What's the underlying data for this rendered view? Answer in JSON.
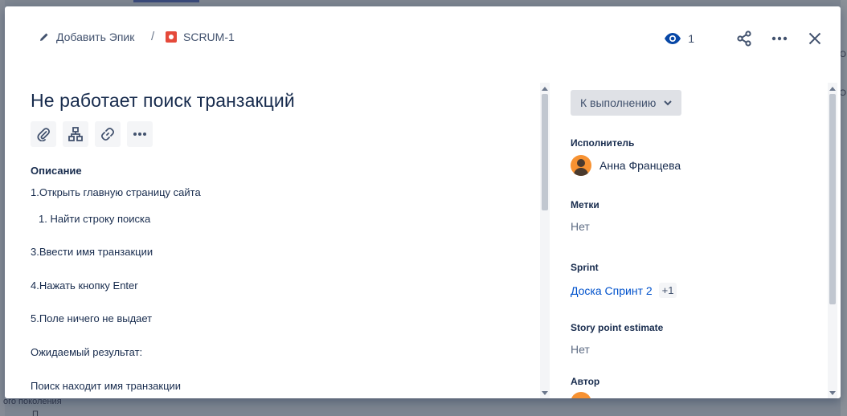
{
  "background": {
    "text_top_right": "Ю",
    "text_mid_right": "О",
    "text_bottom_left": "ого поколения",
    "text_bottom_left2": "П"
  },
  "breadcrumb": {
    "epic_label": "Добавить Эпик",
    "separator": "/",
    "issue_key": "SCRUM-1"
  },
  "header": {
    "watch_count": "1",
    "icons": [
      "eye-icon",
      "share-icon",
      "more-icon",
      "close-icon"
    ]
  },
  "issue": {
    "title": "Не работает поиск транзакций",
    "toolbar_icons": [
      "attachment-icon",
      "child-issue-icon",
      "link-icon",
      "more-icon"
    ],
    "description_label": "Описание",
    "description": [
      "1.Открыть главную страницу сайта",
      "1. Найти строку поиска",
      "3.Ввести имя транзакции",
      "4.Нажать кнопку Enter",
      "5.Поле ничего не выдает",
      "Ожидаемый результат:",
      "Поиск находит имя транзакции"
    ]
  },
  "sidebar": {
    "status": "К выполнению",
    "assignee_label": "Исполнитель",
    "assignee_name": "Анна Францева",
    "labels_label": "Метки",
    "labels_value": "Нет",
    "sprint_label": "Sprint",
    "sprint_value": "Доска Спринт 2",
    "sprint_extra": "+1",
    "story_points_label": "Story point estimate",
    "story_points_value": "Нет",
    "author_label": "Автор"
  },
  "colors": {
    "accent": "#0052cc",
    "issue_type": "#e5493a",
    "avatar": "#f79232",
    "text": "#172b4d"
  }
}
